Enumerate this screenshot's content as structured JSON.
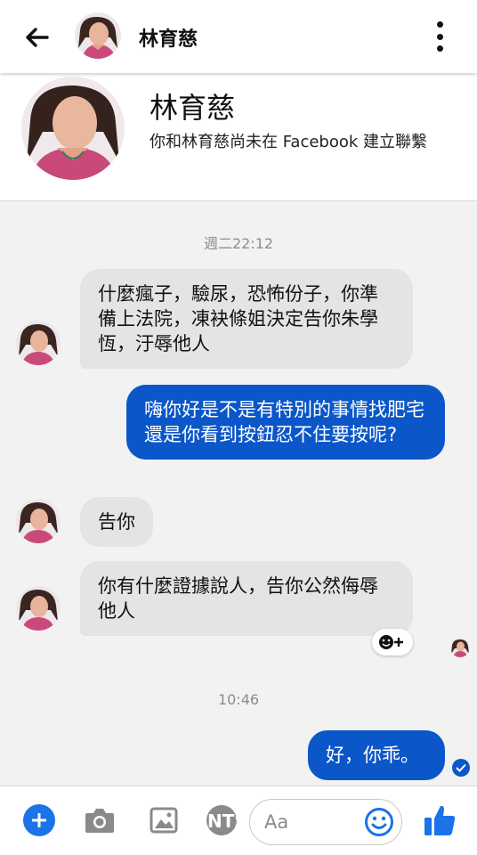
{
  "header": {
    "contact_name": "林育慈",
    "back_icon": "arrow-left-icon",
    "menu_icon": "kebab-menu-icon"
  },
  "profile": {
    "name": "林育慈",
    "connection_note": "你和林育慈尚未在 Facebook 建立聯繫"
  },
  "chat": {
    "timestamp_1": "週二22:12",
    "timestamp_2": "10:46",
    "messages": [
      {
        "from": "them",
        "text": "什麼瘋子，驗尿，恐怖份子，你準備上法院，凍袂條姐決定告你朱學恆，汙辱他人"
      },
      {
        "from": "me",
        "text": "嗨你好是不是有特別的事情找肥宅還是你看到按鈕忍不住要按呢?"
      },
      {
        "from": "them",
        "text": "告你"
      },
      {
        "from": "them",
        "text": "你有什麼證據說人，告你公然侮辱他人"
      },
      {
        "from": "me",
        "text": "好，你乖。"
      }
    ],
    "reaction_icon": "add-reaction-icon"
  },
  "composer": {
    "placeholder": "Aa",
    "icons": [
      "plus-icon",
      "camera-icon",
      "image-icon",
      "sticker-icon",
      "emoji-icon",
      "thumbs-up-icon"
    ]
  },
  "colors": {
    "accent": "#0b57c9",
    "incoming_bubble": "#e4e4e6",
    "chat_background": "#f2f2f3"
  }
}
